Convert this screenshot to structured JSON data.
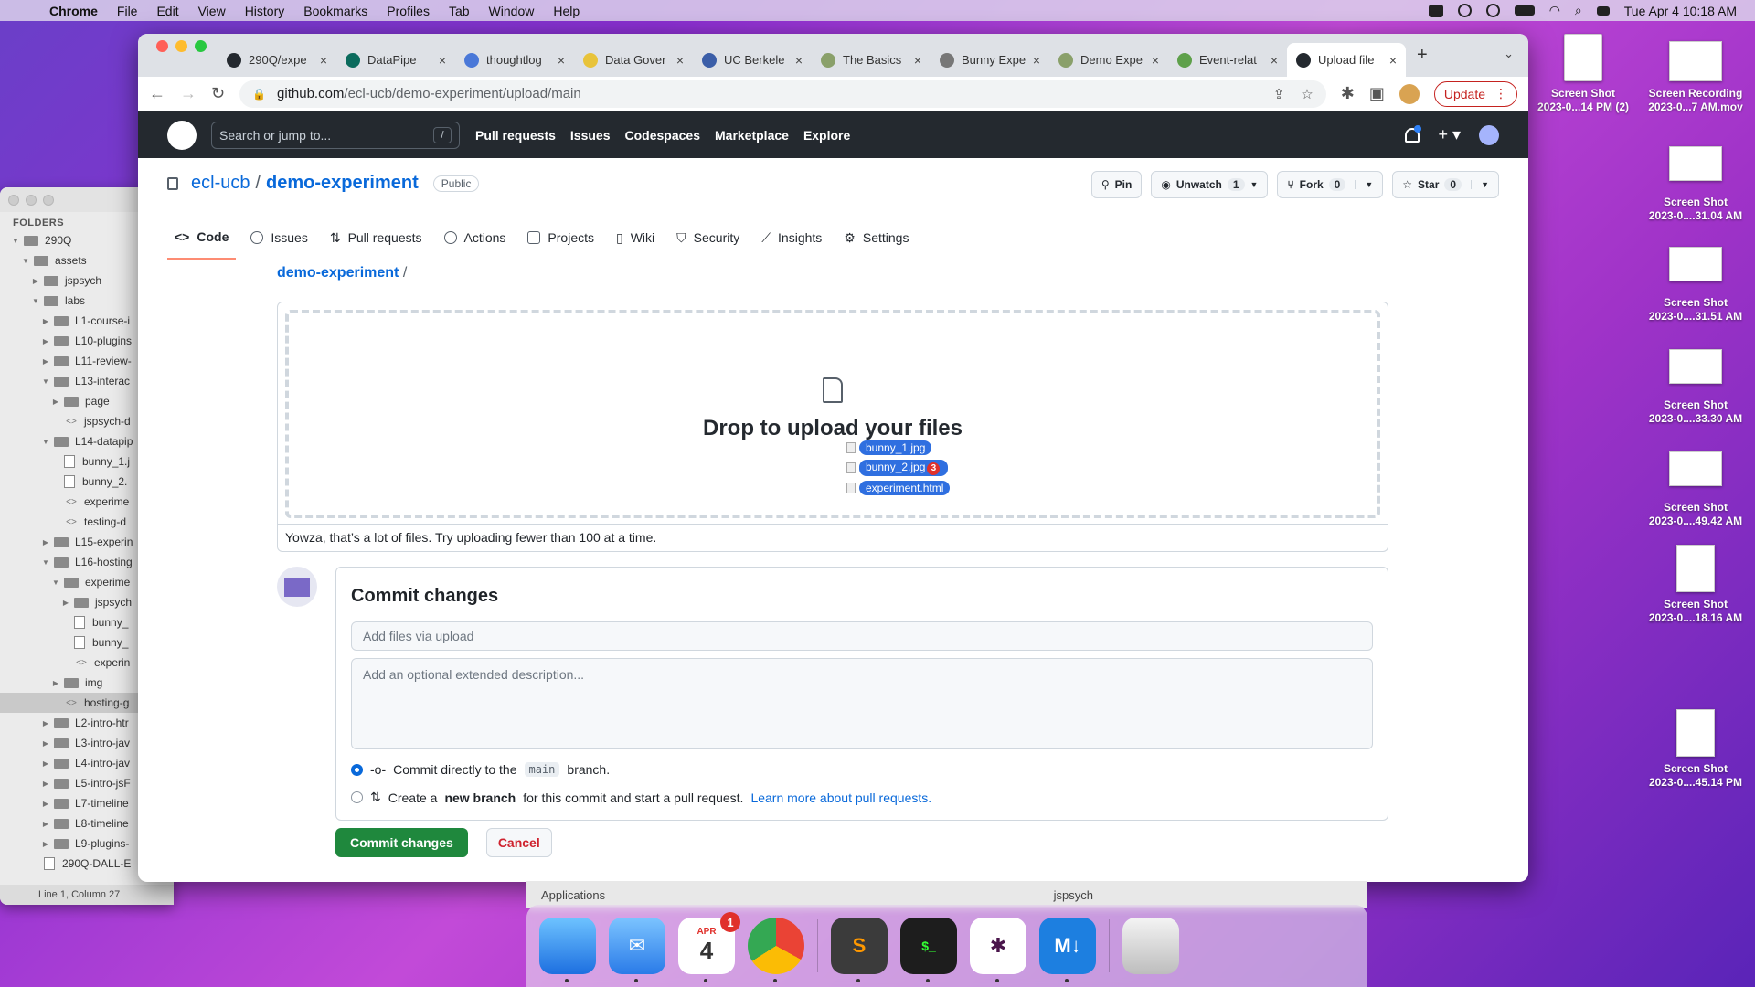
{
  "menubar": {
    "app": "Chrome",
    "items": [
      "File",
      "Edit",
      "View",
      "History",
      "Bookmarks",
      "Profiles",
      "Tab",
      "Window",
      "Help"
    ],
    "datetime": "Tue Apr 4  10:18 AM"
  },
  "desktop_icons": [
    {
      "name": "Screen Shot",
      "sub": "2023-0...14 PM (2)",
      "type": "png"
    },
    {
      "name": "Screen Recording",
      "sub": "2023-0...7 AM.mov",
      "type": "mov"
    },
    {
      "name": "Screen Shot",
      "sub": "2023-0....31.04 AM",
      "type": "shot"
    },
    {
      "name": "Screen Shot",
      "sub": "2023-0....31.51 AM",
      "type": "shot"
    },
    {
      "name": "Screen Shot",
      "sub": "2023-0....33.30 AM",
      "type": "shot"
    },
    {
      "name": "Screen Shot",
      "sub": "2023-0....49.42 AM",
      "type": "shot"
    },
    {
      "name": "Screen Shot",
      "sub": "2023-0....18.16 AM",
      "type": "png"
    },
    {
      "name": "Screen Shot",
      "sub": "2023-0....45.14 PM",
      "type": "png"
    }
  ],
  "sidebar": {
    "header": "FOLDERS",
    "rows": [
      {
        "label": "290Q",
        "depth": 0,
        "kind": "folder",
        "open": true
      },
      {
        "label": "assets",
        "depth": 1,
        "kind": "folder",
        "open": true
      },
      {
        "label": "jspsych",
        "depth": 2,
        "kind": "folder",
        "open": false
      },
      {
        "label": "labs",
        "depth": 2,
        "kind": "folder",
        "open": true
      },
      {
        "label": "L1-course-i",
        "depth": 3,
        "kind": "folder",
        "open": false
      },
      {
        "label": "L10-plugins",
        "depth": 3,
        "kind": "folder",
        "open": false
      },
      {
        "label": "L11-review-",
        "depth": 3,
        "kind": "folder",
        "open": false
      },
      {
        "label": "L13-interac",
        "depth": 3,
        "kind": "folder",
        "open": true
      },
      {
        "label": "page",
        "depth": 4,
        "kind": "folder",
        "open": false
      },
      {
        "label": "jspsych-d",
        "depth": 4,
        "kind": "code"
      },
      {
        "label": "L14-datapip",
        "depth": 3,
        "kind": "folder",
        "open": true
      },
      {
        "label": "bunny_1.j",
        "depth": 4,
        "kind": "file"
      },
      {
        "label": "bunny_2.",
        "depth": 4,
        "kind": "file"
      },
      {
        "label": "experime",
        "depth": 4,
        "kind": "code"
      },
      {
        "label": "testing-d",
        "depth": 4,
        "kind": "code"
      },
      {
        "label": "L15-experin",
        "depth": 3,
        "kind": "folder",
        "open": false
      },
      {
        "label": "L16-hosting",
        "depth": 3,
        "kind": "folder",
        "open": true
      },
      {
        "label": "experime",
        "depth": 4,
        "kind": "folder",
        "open": true
      },
      {
        "label": "jspsych",
        "depth": 5,
        "kind": "folder",
        "open": false
      },
      {
        "label": "bunny_",
        "depth": 5,
        "kind": "file"
      },
      {
        "label": "bunny_",
        "depth": 5,
        "kind": "file"
      },
      {
        "label": "experin",
        "depth": 5,
        "kind": "code"
      },
      {
        "label": "img",
        "depth": 4,
        "kind": "folder",
        "open": false
      },
      {
        "label": "hosting-g",
        "depth": 4,
        "kind": "code",
        "selected": true
      },
      {
        "label": "L2-intro-htr",
        "depth": 3,
        "kind": "folder",
        "open": false
      },
      {
        "label": "L3-intro-jav",
        "depth": 3,
        "kind": "folder",
        "open": false
      },
      {
        "label": "L4-intro-jav",
        "depth": 3,
        "kind": "folder",
        "open": false
      },
      {
        "label": "L5-intro-jsF",
        "depth": 3,
        "kind": "folder",
        "open": false
      },
      {
        "label": "L7-timeline",
        "depth": 3,
        "kind": "folder",
        "open": false
      },
      {
        "label": "L8-timeline",
        "depth": 3,
        "kind": "folder",
        "open": false
      },
      {
        "label": "L9-plugins-",
        "depth": 3,
        "kind": "folder",
        "open": false
      },
      {
        "label": "290Q-DALL-E",
        "depth": 2,
        "kind": "file"
      }
    ],
    "status": "Line 1, Column 27"
  },
  "tabs": [
    {
      "title": "290Q/expe",
      "color": "#24292f"
    },
    {
      "title": "DataPipe",
      "color": "#0b6b5d"
    },
    {
      "title": "thoughtlog",
      "color": "#4a78d8"
    },
    {
      "title": "Data Gover",
      "color": "#e8c33a"
    },
    {
      "title": "UC Berkele",
      "color": "#3b5ea8"
    },
    {
      "title": "The Basics",
      "color": "#8aa06a"
    },
    {
      "title": "Bunny Expe",
      "color": "#777777"
    },
    {
      "title": "Demo Expe",
      "color": "#8aa06a"
    },
    {
      "title": "Event-relat",
      "color": "#5ea04a"
    },
    {
      "title": "Upload file",
      "color": "#24292f",
      "active": true
    }
  ],
  "omnibox": {
    "host": "github.com",
    "path": "/ecl-ucb/demo-experiment/upload/main"
  },
  "update_label": "Update",
  "gh": {
    "search_placeholder": "Search or jump to...",
    "search_key": "/",
    "nav": [
      "Pull requests",
      "Issues",
      "Codespaces",
      "Marketplace",
      "Explore"
    ]
  },
  "repo": {
    "owner": "ecl-ucb",
    "name": "demo-experiment",
    "visibility": "Public",
    "pin": "Pin",
    "unwatch": "Unwatch",
    "watch_count": "1",
    "fork": "Fork",
    "fork_count": "0",
    "star": "Star",
    "star_count": "0",
    "tabs": [
      "Code",
      "Issues",
      "Pull requests",
      "Actions",
      "Projects",
      "Wiki",
      "Security",
      "Insights",
      "Settings"
    ]
  },
  "upload": {
    "breadcrumb": "demo-experiment",
    "breadcrumb_sep": "/",
    "drop_title": "Drop to upload your files",
    "drag_files": [
      "bunny_1.jpg",
      "bunny_2.jpg",
      "experiment.html"
    ],
    "drag_count": "3",
    "error": "Yowza, that’s a lot of files. Try uploading fewer than 100 at a time."
  },
  "commit": {
    "title": "Commit changes",
    "summary_placeholder": "Add files via upload",
    "desc_placeholder": "Add an optional extended description...",
    "opt1_pre": "Commit directly to the",
    "opt1_branch": "main",
    "opt1_post": "branch.",
    "opt2_pre": "Create a",
    "opt2_bold": "new branch",
    "opt2_post": "for this commit and start a pull request.",
    "opt2_link": "Learn more about pull requests.",
    "submit": "Commit changes",
    "cancel": "Cancel"
  },
  "finder": {
    "left": "Applications",
    "right": "jspsych"
  },
  "dock": {
    "calendar_month": "APR",
    "calendar_day": "4",
    "calendar_badge": "1"
  }
}
